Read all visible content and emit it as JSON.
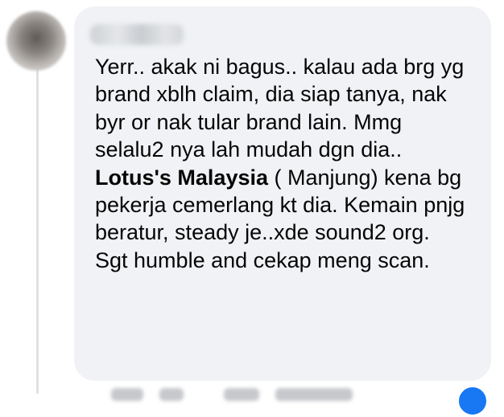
{
  "comment": {
    "author_name": "",
    "text_before_mention": "Yerr.. akak ni bagus.. kalau ada brg yg brand xblh claim, dia siap tanya, nak byr or nak tular brand lain. Mmg selalu2 nya lah mudah dgn dia.. ",
    "mention": "Lotus's Malaysia",
    "text_after_mention": " ( Manjung) kena bg pekerja cemerlang kt dia. Kemain pnjg beratur, steady je..xde sound2 org. Sgt humble and cekap meng scan."
  },
  "icons": {
    "avatar": "profile-photo-blurred",
    "reaction": "like-reaction-icon"
  },
  "colors": {
    "bubble_background": "#f0f2f5",
    "text": "#050505",
    "thread_line": "#dfe1e5",
    "reaction_blue": "#1877f2"
  }
}
